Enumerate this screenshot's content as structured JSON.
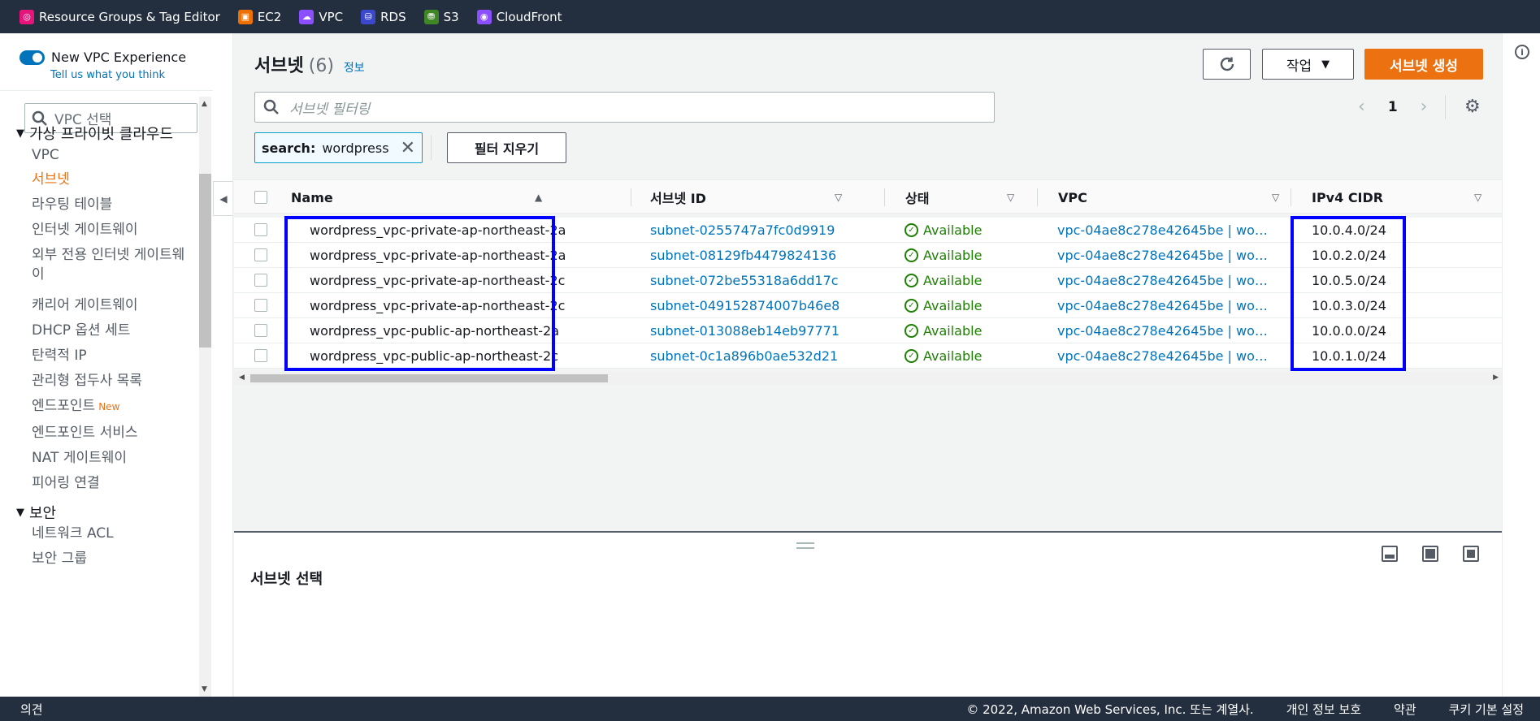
{
  "topbar": {
    "favorites": [
      {
        "label": "Resource Groups & Tag Editor",
        "icon": "resource-groups-icon",
        "color": "#e7157b"
      },
      {
        "label": "EC2",
        "icon": "ec2-icon",
        "color": "#ed7100"
      },
      {
        "label": "VPC",
        "icon": "vpc-icon",
        "color": "#8c4fff"
      },
      {
        "label": "RDS",
        "icon": "rds-icon",
        "color": "#3b48cc"
      },
      {
        "label": "S3",
        "icon": "s3-icon",
        "color": "#3f8624"
      },
      {
        "label": "CloudFront",
        "icon": "cloudfront-icon",
        "color": "#8c4fff"
      }
    ]
  },
  "sidebar": {
    "toggle_label": "New VPC Experience",
    "tell_link": "Tell us what you think",
    "vpc_select_placeholder": "VPC 선택",
    "section_vpc": "가상 프라이빗 클라우드",
    "items": [
      {
        "label": "VPC"
      },
      {
        "label": "서브넷"
      },
      {
        "label": "라우팅 테이블"
      },
      {
        "label": "인터넷 게이트웨이"
      },
      {
        "label": "외부 전용 인터넷 게이트웨이"
      },
      {
        "label": "캐리어 게이트웨이"
      },
      {
        "label": "DHCP 옵션 세트"
      },
      {
        "label": "탄력적 IP"
      },
      {
        "label": "관리형 접두사 목록"
      },
      {
        "label": "엔드포인트",
        "badge": "New"
      },
      {
        "label": "엔드포인트 서비스"
      },
      {
        "label": "NAT 게이트웨이"
      },
      {
        "label": "피어링 연결"
      }
    ],
    "section_security": "보안",
    "security_items": [
      {
        "label": "네트워크 ACL"
      },
      {
        "label": "보안 그룹"
      }
    ]
  },
  "main": {
    "title": "서브넷",
    "count": "(6)",
    "info": "정보",
    "actions_label": "작업",
    "create_label": "서브넷 생성",
    "filter_placeholder": "서브넷 필터링",
    "page": "1",
    "token_key": "search:",
    "token_value": "wordpress",
    "clear_filters": "필터 지우기",
    "columns": [
      "Name",
      "서브넷 ID",
      "상태",
      "VPC",
      "IPv4 CIDR"
    ],
    "rows": [
      {
        "name": "wordpress_vpc-private-ap-northeast-2a",
        "id": "subnet-0255747a7fc0d9919",
        "status": "Available",
        "vpc": "vpc-04ae8c278e42645be | wo…",
        "cidr": "10.0.4.0/24"
      },
      {
        "name": "wordpress_vpc-private-ap-northeast-2a",
        "id": "subnet-08129fb4479824136",
        "status": "Available",
        "vpc": "vpc-04ae8c278e42645be | wo…",
        "cidr": "10.0.2.0/24"
      },
      {
        "name": "wordpress_vpc-private-ap-northeast-2c",
        "id": "subnet-072be55318a6dd17c",
        "status": "Available",
        "vpc": "vpc-04ae8c278e42645be | wo…",
        "cidr": "10.0.5.0/24"
      },
      {
        "name": "wordpress_vpc-private-ap-northeast-2c",
        "id": "subnet-049152874007b46e8",
        "status": "Available",
        "vpc": "vpc-04ae8c278e42645be | wo…",
        "cidr": "10.0.3.0/24"
      },
      {
        "name": "wordpress_vpc-public-ap-northeast-2a",
        "id": "subnet-013088eb14eb97771",
        "status": "Available",
        "vpc": "vpc-04ae8c278e42645be | wo…",
        "cidr": "10.0.0.0/24"
      },
      {
        "name": "wordpress_vpc-public-ap-northeast-2c",
        "id": "subnet-0c1a896b0ae532d21",
        "status": "Available",
        "vpc": "vpc-04ae8c278e42645be | wo…",
        "cidr": "10.0.1.0/24"
      }
    ],
    "split_title": "서브넷 선택"
  },
  "footer": {
    "feedback": "의견",
    "copyright": "© 2022, Amazon Web Services, Inc. 또는 계열사.",
    "privacy": "개인 정보 보호",
    "terms": "약관",
    "cookies": "쿠키 기본 설정"
  },
  "colors": {
    "accent": "#ec7211",
    "link": "#0073bb",
    "success": "#1d8102",
    "highlight": "#0000ff",
    "header": "#232f3e"
  }
}
